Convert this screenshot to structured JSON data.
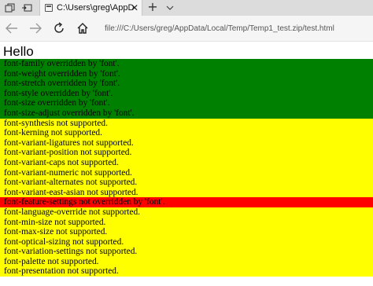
{
  "browser": {
    "tab_title": "C:\\Users\\greg\\AppData",
    "tab_close": "✕",
    "new_tab": "+",
    "tab_menu": "⌄",
    "address_url": "file:///C:/Users/greg/AppData/Local/Temp/Temp1_test.zip/test.html"
  },
  "page": {
    "heading": "Hello",
    "colors": {
      "overridden": "#008000",
      "not_supported": "#ffff00",
      "not_overridden": "#ff0000"
    },
    "rows": [
      {
        "text": "font-family overridden by 'font'.",
        "status": "green"
      },
      {
        "text": "font-weight overridden by 'font'.",
        "status": "green"
      },
      {
        "text": "font-stretch overridden by 'font'.",
        "status": "green"
      },
      {
        "text": "font-style overridden by 'font'.",
        "status": "green"
      },
      {
        "text": "font-size overridden by 'font'.",
        "status": "green"
      },
      {
        "text": "font-size-adjust overridden by 'font'.",
        "status": "green"
      },
      {
        "text": "font-synthesis not supported.",
        "status": "yellow"
      },
      {
        "text": "font-kerning not supported.",
        "status": "yellow"
      },
      {
        "text": "font-variant-ligatures not supported.",
        "status": "yellow"
      },
      {
        "text": "font-variant-position not supported.",
        "status": "yellow"
      },
      {
        "text": "font-variant-caps not supported.",
        "status": "yellow"
      },
      {
        "text": "font-variant-numeric not supported.",
        "status": "yellow"
      },
      {
        "text": "font-variant-alternates not supported.",
        "status": "yellow"
      },
      {
        "text": "font-variant-east-asian not supported.",
        "status": "yellow"
      },
      {
        "text": "font-feature-settings not overridden by 'font'.",
        "status": "red"
      },
      {
        "text": "font-language-override not supported.",
        "status": "yellow"
      },
      {
        "text": "font-min-size not supported.",
        "status": "yellow"
      },
      {
        "text": "font-max-size not supported.",
        "status": "yellow"
      },
      {
        "text": "font-optical-sizing not supported.",
        "status": "yellow"
      },
      {
        "text": "font-variation-settings not supported.",
        "status": "yellow"
      },
      {
        "text": "font-palette not supported.",
        "status": "yellow"
      },
      {
        "text": "font-presentation not supported.",
        "status": "yellow"
      }
    ]
  }
}
